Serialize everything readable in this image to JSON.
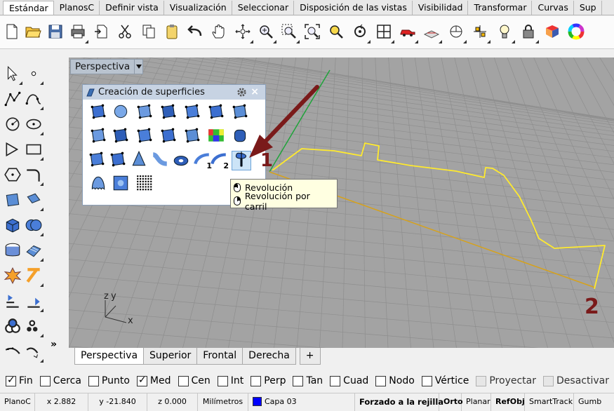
{
  "tabs": [
    "Estándar",
    "PlanosC",
    "Definir vista",
    "Visualización",
    "Seleccionar",
    "Disposición de las vistas",
    "Visibilidad",
    "Transformar",
    "Curvas",
    "Sup"
  ],
  "active_tab": "Estándar",
  "toolbar_icons": [
    "new-file-icon",
    "open-folder-icon",
    "save-icon",
    "print-icon",
    "import-icon",
    "cut-icon",
    "copy-icon",
    "paste-icon",
    "undo-icon",
    "pan-hand-icon",
    "rotate-view-icon",
    "zoom-icon",
    "zoom-window-icon",
    "zoom-extents-icon",
    "zoom-selected-icon",
    "rotate-icon",
    "four-viewports-icon",
    "car-icon",
    "plan-icon",
    "cplane-icon",
    "point-icon",
    "light-icon",
    "lock-icon",
    "material-icon",
    "color-wheel-icon"
  ],
  "viewport": {
    "title": "Perspectiva",
    "axis_z": "z",
    "axis_y": "y",
    "axis_x": "x"
  },
  "panel": {
    "title": "Creación de superficies",
    "close": "×",
    "icons": [
      "srf-from-points-icon",
      "sphere-srf-icon",
      "patch-icon",
      "loft-icon",
      "network-srf-icon",
      "edge-srf-icon",
      "plane-srf-icon",
      "srf-from-curves-icon",
      "rectangle-plane-icon",
      "sweep1-icon",
      "sweep2-icon",
      "extrude-crv-icon",
      "heightfield-icon",
      "cylinder-srf-icon",
      "blend-srf-icon",
      "rail-revolve-icon",
      "cone-srf-icon",
      "tube-icon",
      "torus-srf-icon",
      "revolve-1-icon",
      "revolve-2-icon",
      "revolve-icon",
      "drape-icon",
      "heightfield-image-icon",
      "point-grid-icon"
    ],
    "sub_label_1": "1",
    "sub_label_2": "2"
  },
  "tooltip": {
    "left_click": "Revolución",
    "right_click": "Revolución por carril"
  },
  "annotations": {
    "one": "1",
    "two": "2"
  },
  "viewport_tabs": [
    "Perspectiva",
    "Superior",
    "Frontal",
    "Derecha"
  ],
  "viewport_tab_add": "+",
  "osnaps": [
    {
      "label": "Fin",
      "checked": true
    },
    {
      "label": "Cerca",
      "checked": false
    },
    {
      "label": "Punto",
      "checked": false
    },
    {
      "label": "Med",
      "checked": true
    },
    {
      "label": "Cen",
      "checked": false
    },
    {
      "label": "Int",
      "checked": false
    },
    {
      "label": "Perp",
      "checked": false
    },
    {
      "label": "Tan",
      "checked": false
    },
    {
      "label": "Cuad",
      "checked": false
    },
    {
      "label": "Nodo",
      "checked": false
    },
    {
      "label": "Vértice",
      "checked": false
    },
    {
      "label": "Proyectar",
      "checked": false,
      "disabled": true
    },
    {
      "label": "Desactivar",
      "checked": false,
      "disabled": true
    }
  ],
  "status": {
    "cplane": "PlanoC",
    "x": "x 2.882",
    "y": "y -21.840",
    "z": "z 0.000",
    "units": "Milímetros",
    "layer": "Capa 03",
    "grid_snap": "Forzado a la rejilla",
    "ortho": "Orto",
    "planar": "Planar",
    "osnap": "RefObj",
    "smarttrack": "SmartTrack",
    "gumball": "Gumb"
  },
  "colors": {
    "curve": "#ffea2e",
    "arrow": "#7a1a1a",
    "selected_accent": "#6ea4d8",
    "layer": "#0000ff"
  }
}
